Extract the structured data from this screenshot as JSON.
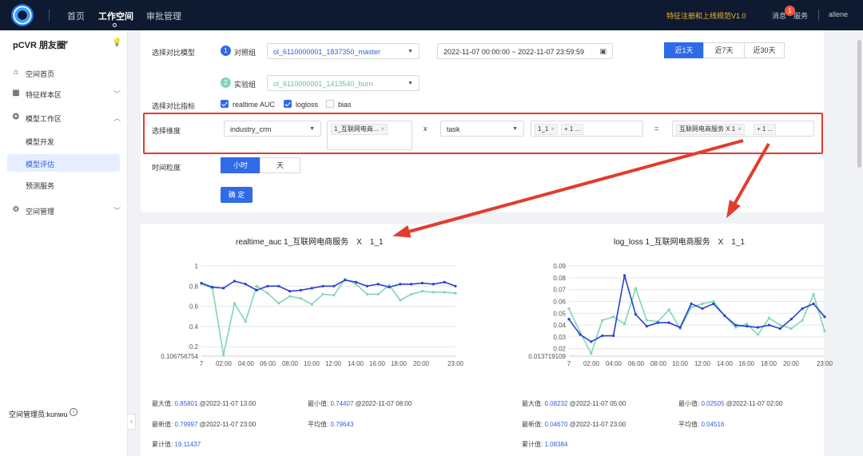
{
  "header": {
    "nav": [
      "首页",
      "工作空间",
      "审批管理"
    ],
    "notice": "特征注册和上线规范V1.0",
    "messages_label": "消息",
    "messages_count": "1",
    "service_label": "服务",
    "user": "allene"
  },
  "sidebar": {
    "space_name": "pCVR 朋友圈",
    "items": [
      {
        "label": "空间首页",
        "icon": "home-icon"
      },
      {
        "label": "特征样本区",
        "icon": "database-icon"
      },
      {
        "label": "模型工作区",
        "icon": "model-icon"
      }
    ],
    "sub_items": [
      "模型开发",
      "模型评估",
      "预测服务"
    ],
    "selected_sub": "模型评估",
    "space_manage": "空间管理",
    "admin": "空间管理员:kunwu"
  },
  "form": {
    "compare_model_label": "选择对比模型",
    "control_label": "对照组",
    "control_value": "ol_6110000001_1837350_master",
    "experiment_label": "实验组",
    "experiment_value": "ol_6110000001_1413540_burn",
    "time_range": "2022-11-07 00:00:00 ~ 2022-11-07 23:59:59",
    "range_buttons": [
      "近1天",
      "近7天",
      "近30天"
    ],
    "metric_label": "选择对比指标",
    "metrics": [
      {
        "label": "realtime AUC",
        "checked": true
      },
      {
        "label": "logloss",
        "checked": true
      },
      {
        "label": "bias",
        "checked": false
      }
    ],
    "dimension_label": "选择维度",
    "dim1": "industry_crm",
    "dim1_tag": "1_互联网电商...",
    "times_sign": "x",
    "dim2": "task",
    "dim2_tags": [
      "1_1",
      "+ 1 ..."
    ],
    "equals_sign": "=",
    "result_tags": [
      "互联网电商服务 X 1",
      "+ 1 ..."
    ],
    "granularity_label": "时间粒度",
    "granularity_options": [
      "小时",
      "天"
    ],
    "confirm": "确 定"
  },
  "charts": {
    "left": {
      "title": "realtime_auc 1_互联网电商服务　X　1_1",
      "y_ticks": [
        "1",
        "0.8",
        "0.6",
        "0.4",
        "0.2",
        "0.106756754"
      ],
      "x_ticks": [
        "7",
        "02:00",
        "04:00",
        "06:00",
        "08:00",
        "10:00",
        "12:00",
        "14:00",
        "16:00",
        "18:00",
        "20:00",
        "23:00"
      ],
      "stats": {
        "max_label": "最大值:",
        "max": "0.85801",
        "max_time": "@2022-11-07 13:00",
        "min_label": "最小值:",
        "min": "0.74407",
        "min_time": "@2022-11-07 08:00",
        "latest_label": "最新值:",
        "latest": "0.79997",
        "latest_time": "@2022-11-07 23:00",
        "avg_label": "平均值:",
        "avg": "0.79643",
        "sum_label": "累计值:",
        "sum": "19.11437"
      }
    },
    "right": {
      "title": "log_loss 1_互联网电商服务　X　1_1",
      "y_ticks": [
        "0.09",
        "0.08",
        "0.07",
        "0.06",
        "0.05",
        "0.04",
        "0.03",
        "0.02",
        "0.013719109"
      ],
      "x_ticks": [
        "7",
        "02:00",
        "04:00",
        "06:00",
        "08:00",
        "10:00",
        "12:00",
        "14:00",
        "16:00",
        "18:00",
        "20:00",
        "23:00"
      ],
      "stats": {
        "max_label": "最大值:",
        "max": "0.08232",
        "max_time": "@2022-11-07 05:00",
        "min_label": "最小值:",
        "min": "0.02505",
        "min_time": "@2022-11-07 02:00",
        "latest_label": "最新值:",
        "latest": "0.04670",
        "latest_time": "@2022-11-07 23:00",
        "avg_label": "平均值:",
        "avg": "0.04516",
        "sum_label": "累计值:",
        "sum": "1.08384"
      }
    }
  },
  "chart_data": [
    {
      "type": "line",
      "title": "realtime_auc 1_互联网电商服务　X　1_1",
      "x": [
        0,
        1,
        2,
        3,
        4,
        5,
        6,
        7,
        8,
        9,
        10,
        11,
        12,
        13,
        14,
        15,
        16,
        17,
        18,
        19,
        20,
        21,
        22,
        23
      ],
      "ylim": [
        0.106756754,
        1
      ],
      "series": [
        {
          "color": "#2a3fd1",
          "values": [
            0.83,
            0.79,
            0.78,
            0.85,
            0.82,
            0.76,
            0.8,
            0.8,
            0.75,
            0.76,
            0.78,
            0.8,
            0.8,
            0.86,
            0.84,
            0.8,
            0.82,
            0.79,
            0.82,
            0.82,
            0.83,
            0.82,
            0.84,
            0.8
          ]
        },
        {
          "color": "#7fd6b6",
          "values": [
            0.82,
            0.78,
            0.12,
            0.63,
            0.45,
            0.8,
            0.73,
            0.63,
            0.7,
            0.68,
            0.62,
            0.72,
            0.71,
            0.87,
            0.82,
            0.72,
            0.72,
            0.81,
            0.66,
            0.72,
            0.75,
            0.74,
            0.74,
            0.73
          ]
        }
      ]
    },
    {
      "type": "line",
      "title": "log_loss 1_互联网电商服务　X　1_1",
      "x": [
        0,
        1,
        2,
        3,
        4,
        5,
        6,
        7,
        8,
        9,
        10,
        11,
        12,
        13,
        14,
        15,
        16,
        17,
        18,
        19,
        20,
        21,
        22,
        23
      ],
      "ylim": [
        0.013719109,
        0.09
      ],
      "series": [
        {
          "color": "#2a3fd1",
          "values": [
            0.045,
            0.032,
            0.026,
            0.031,
            0.031,
            0.082,
            0.049,
            0.039,
            0.042,
            0.042,
            0.038,
            0.058,
            0.054,
            0.058,
            0.048,
            0.04,
            0.039,
            0.038,
            0.04,
            0.037,
            0.045,
            0.054,
            0.058,
            0.047
          ]
        },
        {
          "color": "#7fd6b6",
          "values": [
            0.054,
            0.034,
            0.016,
            0.044,
            0.047,
            0.041,
            0.071,
            0.044,
            0.043,
            0.053,
            0.037,
            0.055,
            0.058,
            0.06,
            0.048,
            0.038,
            0.041,
            0.032,
            0.046,
            0.04,
            0.037,
            0.044,
            0.066,
            0.035
          ]
        }
      ]
    }
  ]
}
